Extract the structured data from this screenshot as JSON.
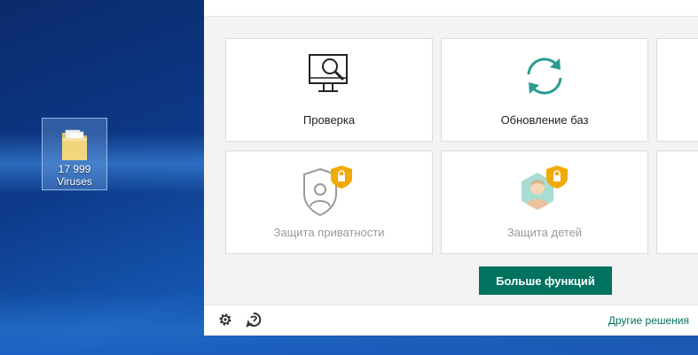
{
  "desktop": {
    "icon": {
      "name": "folder-icon",
      "label_line1": "17 999",
      "label_line2": "Viruses"
    }
  },
  "app": {
    "tiles": [
      {
        "id": "scan",
        "label": "Проверка",
        "icon": "monitor-search-icon",
        "locked": false
      },
      {
        "id": "update",
        "label": "Обновление баз",
        "icon": "refresh-icon",
        "locked": false
      },
      {
        "id": "privacy",
        "label": "Защита приватности",
        "icon": "privacy-shield-icon",
        "locked": true
      },
      {
        "id": "kids",
        "label": "Защита детей",
        "icon": "child-protection-icon",
        "locked": true
      }
    ],
    "more_button": "Больше функций",
    "footer": {
      "settings_icon": "gear-icon",
      "support_icon": "support-icon",
      "other_link": "Другие решения"
    },
    "colors": {
      "accent": "#00725e",
      "teal": "#2a9d8f",
      "lock": "#f2a900"
    }
  }
}
